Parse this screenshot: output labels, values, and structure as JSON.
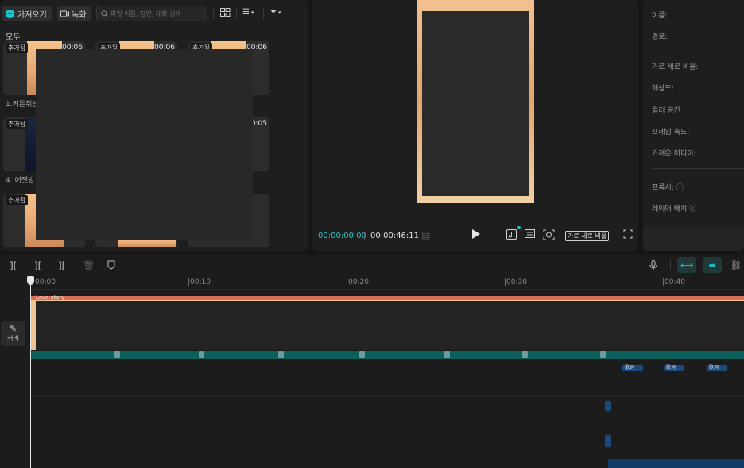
{
  "media": {
    "import_label": "가져오기",
    "record_label": "녹화",
    "search_placeholder": "파일 이름, 장면, 대화 검색",
    "section_label": "모두",
    "added_badge": "추가됨",
    "items": [
      {
        "duration": "00:06",
        "caption": "1.커튼취는"
      },
      {
        "duration": "00:06",
        "caption": ""
      },
      {
        "duration": "00:06",
        "caption": ""
      },
      {
        "duration": "00:05",
        "caption": "4. 어젯밤"
      },
      {
        "duration": "",
        "caption": ""
      },
      {
        "duration": "",
        "caption": ""
      }
    ]
  },
  "preview": {
    "current_time": "00:00:00:00",
    "separator": "|",
    "total_time": "00:00:46:11",
    "ratio_label": "가로 세로 비율"
  },
  "properties": {
    "labels": [
      "이름:",
      "경로:",
      "가로 세로 비율:",
      "해상도:",
      "컬러 공간",
      "프레임 속도:",
      "가져온 미디어:"
    ],
    "proxy_label": "프록시:",
    "layer_label": "레이어 배치"
  },
  "timeline": {
    "cover_label": "커버",
    "track_title": "Love story",
    "ruler_labels": [
      "00:00",
      "00:10",
      "00:20",
      "00:30",
      "00:40"
    ],
    "lyric_clip_label": "歌词"
  },
  "colors": {
    "accent": "#1fc7cf",
    "main_track_title": "#d96c56",
    "audio_band": "#0d5f5c",
    "lyric_clip": "#1b4a7a"
  }
}
